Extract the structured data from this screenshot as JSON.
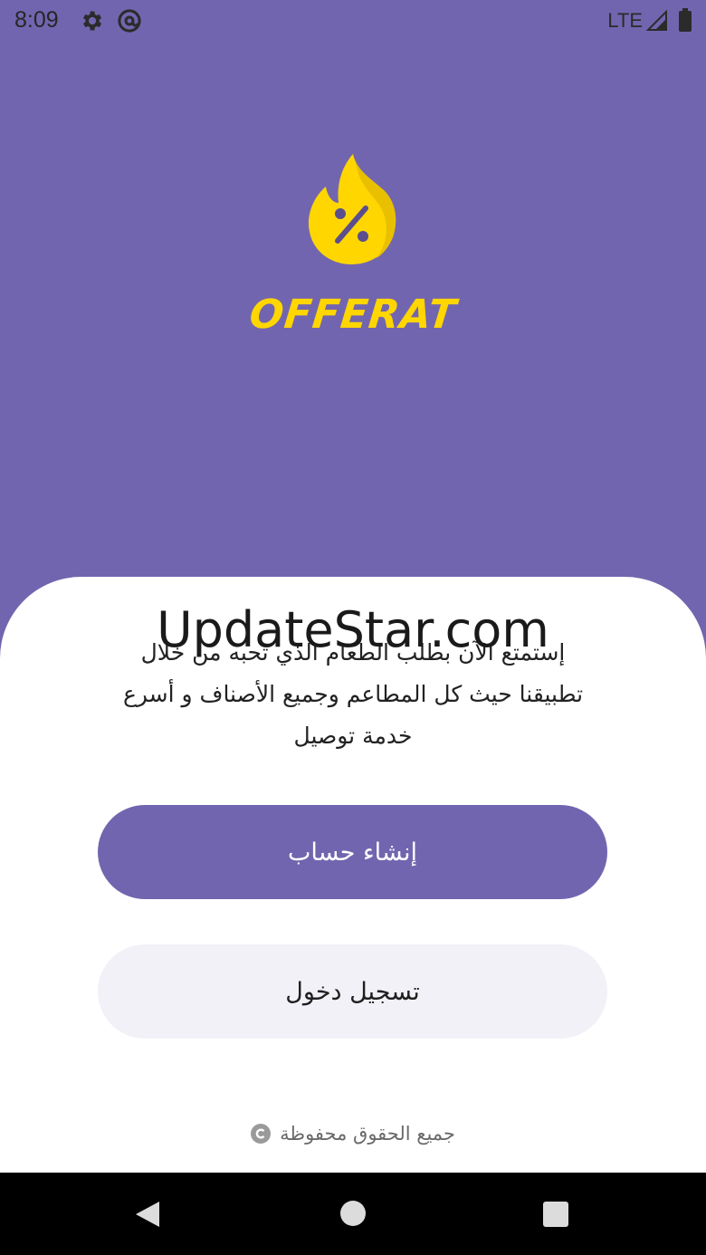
{
  "status_bar": {
    "time": "8:09",
    "network": "LTE",
    "icons": [
      "gear-icon",
      "at-sign-icon",
      "signal-icon",
      "battery-icon"
    ]
  },
  "brand": {
    "name": "OFFERAT",
    "logo_icon": "percent-flame-icon",
    "logo_color": "#FFD600",
    "logo_symbol": "%"
  },
  "watermark": "UpdateStar.com",
  "intro": {
    "description": "إستمتع الآن بطلب الطعام الذي تحبه من خلال تطبيقنا حيث كل المطاعم وجميع الأصناف و أسرع خدمة توصيل"
  },
  "actions": {
    "create_account": "إنشاء حساب",
    "login": "تسجيل دخول"
  },
  "footer": {
    "copyright": "جميع الحقوق محفوظة",
    "copyright_icon": "copyright-icon"
  },
  "nav_bar": {
    "icons": [
      "back-icon",
      "home-icon",
      "recents-icon"
    ]
  },
  "colors": {
    "primary": "#7265AF",
    "accent": "#FFD600",
    "secondary_button": "#F2F1F7"
  }
}
